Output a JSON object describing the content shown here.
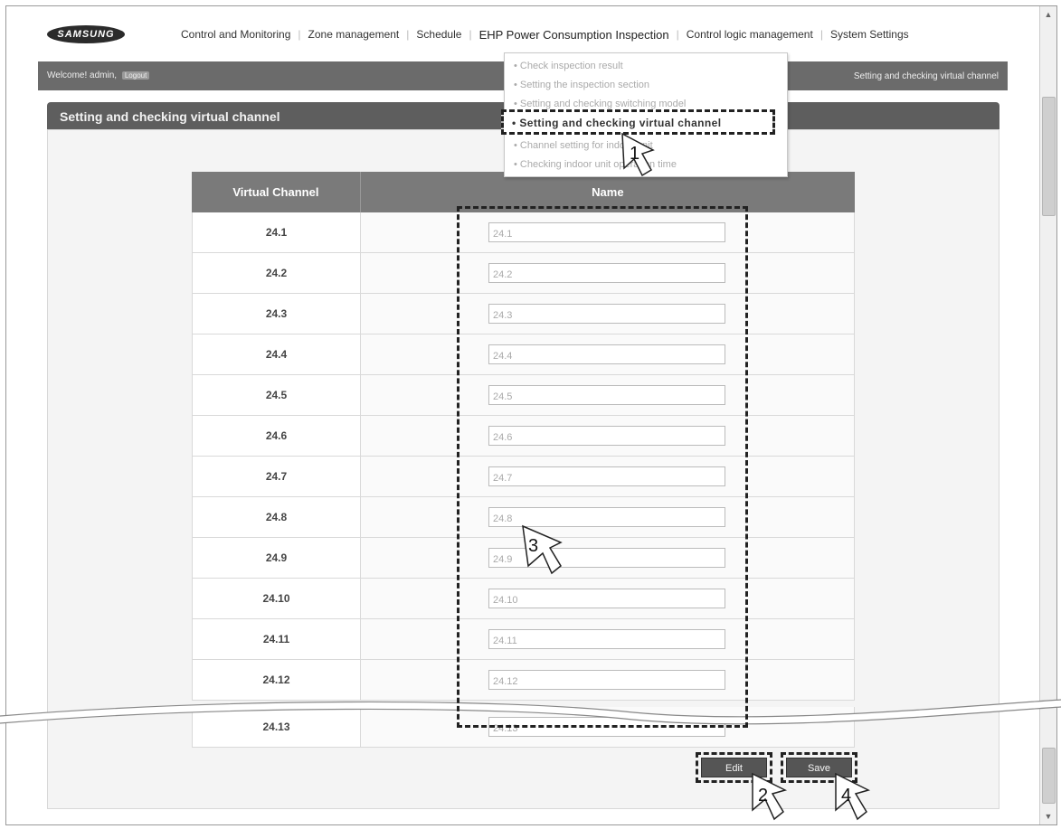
{
  "brand": {
    "logo_text": "SAMSUNG"
  },
  "nav": {
    "items": [
      {
        "label": "Control and Monitoring"
      },
      {
        "label": "Zone management"
      },
      {
        "label": "Schedule"
      },
      {
        "label": "EHP Power Consumption Inspection"
      },
      {
        "label": "Control logic management"
      },
      {
        "label": "System Settings"
      }
    ]
  },
  "welcome_bar": {
    "welcome_text": "Welcome! admin,",
    "logout_label": "Logout",
    "current_page": "Setting and checking virtual channel"
  },
  "dropdown": {
    "items": [
      {
        "label": "• Check inspection result"
      },
      {
        "label": "• Setting the inspection section"
      },
      {
        "label": "• Setting and checking switching model"
      },
      {
        "label": "• Setting and checking virtual channel"
      },
      {
        "label": "• Channel setting for indoor unit"
      },
      {
        "label": "• Checking indoor unit operation time"
      }
    ]
  },
  "section": {
    "title": "Setting and checking virtual channel"
  },
  "table": {
    "headers": {
      "channel": "Virtual Channel",
      "name": "Name"
    },
    "rows": [
      {
        "channel": "24.1",
        "name": "24.1"
      },
      {
        "channel": "24.2",
        "name": "24.2"
      },
      {
        "channel": "24.3",
        "name": "24.3"
      },
      {
        "channel": "24.4",
        "name": "24.4"
      },
      {
        "channel": "24.5",
        "name": "24.5"
      },
      {
        "channel": "24.6",
        "name": "24.6"
      },
      {
        "channel": "24.7",
        "name": "24.7"
      },
      {
        "channel": "24.8",
        "name": "24.8"
      },
      {
        "channel": "24.9",
        "name": "24.9"
      },
      {
        "channel": "24.10",
        "name": "24.10"
      },
      {
        "channel": "24.11",
        "name": "24.11"
      },
      {
        "channel": "24.12",
        "name": "24.12"
      },
      {
        "channel": "24.13",
        "name": "24.13"
      }
    ]
  },
  "buttons": {
    "edit_label": "Edit",
    "save_label": "Save"
  },
  "steps": {
    "one": "1",
    "two": "2",
    "three": "3",
    "four": "4"
  }
}
